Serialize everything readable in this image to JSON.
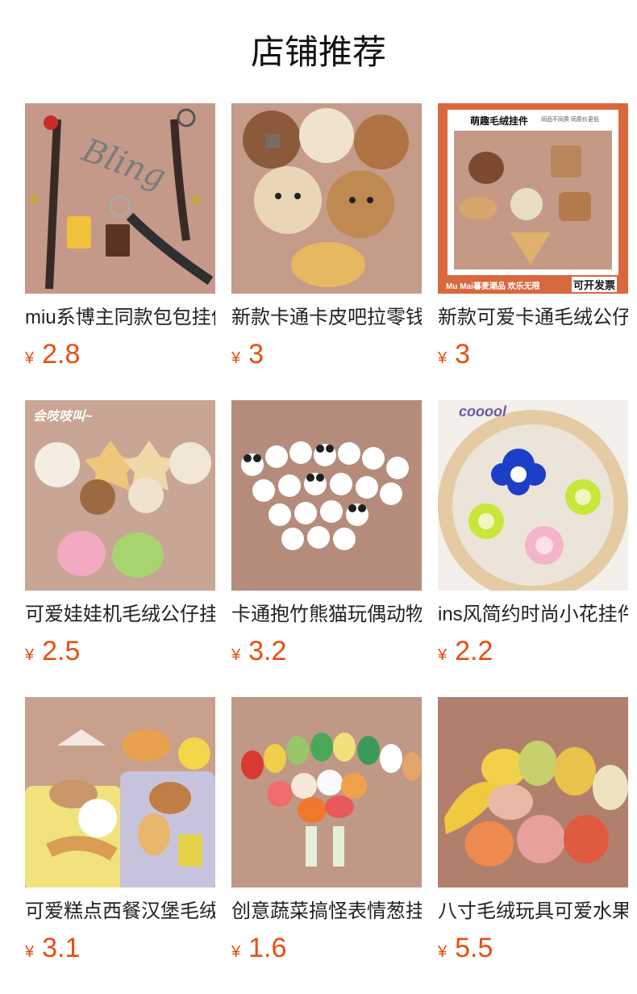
{
  "header": {
    "title": "店铺推荐"
  },
  "currency_symbol": "¥",
  "products": [
    {
      "name": "miu系博主同款包包挂件",
      "price": "2.8",
      "bg": "#c4998a"
    },
    {
      "name": "新款卡通卡皮吧拉零钱包",
      "price": "3",
      "bg": "#c59c8a"
    },
    {
      "name": "新款可爱卡通毛绒公仔挂件",
      "price": "3",
      "bg": "#d8683e",
      "overlay_text": "萌趣毛绒挂件",
      "overlay_sub": "同品不同质 同质价更低",
      "footer_left": "Mu Mai暮麦潮品 欢乐无限",
      "footer_right": "可开发票"
    },
    {
      "name": "可爱娃娃机毛绒公仔挂件",
      "price": "2.5",
      "bg": "#c8a595",
      "overlay_text": "会吱吱叫~"
    },
    {
      "name": "卡通抱竹熊猫玩偶动物挂件",
      "price": "3.2",
      "bg": "#b58c7c"
    },
    {
      "name": "ins风简约时尚小花挂件",
      "price": "2.2",
      "bg": "#f3efea",
      "overlay_text": "cooool"
    },
    {
      "name": "可爱糕点西餐汉堡毛绒挂件",
      "price": "3.1",
      "bg": "#c9a08c"
    },
    {
      "name": "创意蔬菜搞怪表情葱挂件",
      "price": "1.6",
      "bg": "#c09886"
    },
    {
      "name": "八寸毛绒玩具可爱水果公仔",
      "price": "5.5",
      "bg": "#b1806d"
    }
  ]
}
